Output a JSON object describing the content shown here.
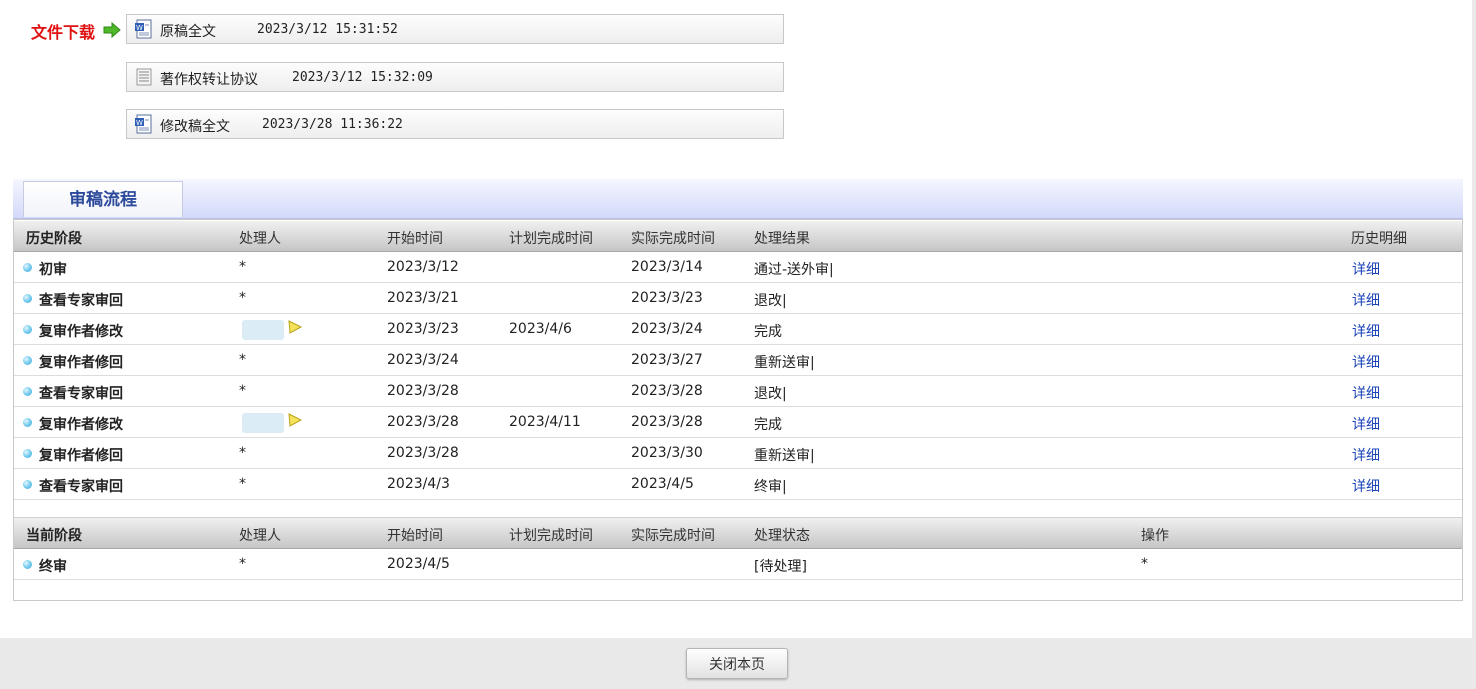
{
  "downloads": {
    "label": "文件下载",
    "files": [
      {
        "name": "原稿全文",
        "date": "2023/3/12 15:31:52",
        "icon": "word-doc-icon"
      },
      {
        "name": "著作权转让协议",
        "date": "2023/3/12 15:32:09",
        "icon": "text-doc-icon"
      },
      {
        "name": "修改稿全文",
        "date": "2023/3/28 11:36:22",
        "icon": "word-doc-icon"
      }
    ]
  },
  "section_title": "审稿流程",
  "history": {
    "headers": [
      "历史阶段",
      "处理人",
      "开始时间",
      "计划完成时间",
      "实际完成时间",
      "处理结果",
      "历史明细"
    ],
    "rows": [
      {
        "stage": "初审",
        "handler": "*",
        "start": "2023/3/12",
        "planned": "",
        "actual": "2023/3/14",
        "result": "通过-送外审|",
        "detail": "详细"
      },
      {
        "stage": "查看专家审回",
        "handler": "*",
        "start": "2023/3/21",
        "planned": "",
        "actual": "2023/3/23",
        "result": "退改|",
        "detail": "详细"
      },
      {
        "stage": "复审作者修改",
        "handler": "",
        "start": "2023/3/23",
        "planned": "2023/4/6",
        "actual": "2023/3/24",
        "result": "完成",
        "detail": "详细"
      },
      {
        "stage": "复审作者修回",
        "handler": "*",
        "start": "2023/3/24",
        "planned": "",
        "actual": "2023/3/27",
        "result": "重新送审|",
        "detail": "详细"
      },
      {
        "stage": "查看专家审回",
        "handler": "*",
        "start": "2023/3/28",
        "planned": "",
        "actual": "2023/3/28",
        "result": "退改|",
        "detail": "详细"
      },
      {
        "stage": "复审作者修改",
        "handler": "",
        "start": "2023/3/28",
        "planned": "2023/4/11",
        "actual": "2023/3/28",
        "result": "完成",
        "detail": "详细"
      },
      {
        "stage": "复审作者修回",
        "handler": "*",
        "start": "2023/3/28",
        "planned": "",
        "actual": "2023/3/30",
        "result": "重新送审|",
        "detail": "详细"
      },
      {
        "stage": "查看专家审回",
        "handler": "*",
        "start": "2023/4/3",
        "planned": "",
        "actual": "2023/4/5",
        "result": "终审|",
        "detail": "详细"
      }
    ]
  },
  "current": {
    "headers": [
      "当前阶段",
      "处理人",
      "开始时间",
      "计划完成时间",
      "实际完成时间",
      "处理状态",
      "操作"
    ],
    "rows": [
      {
        "stage": "终审",
        "handler": "*",
        "start": "2023/4/5",
        "planned": "",
        "actual": "",
        "status": "[待处理]",
        "action": "*"
      }
    ]
  },
  "footer": {
    "close_label": "关闭本页"
  },
  "colors": {
    "download_label": "#e01010",
    "section_title": "#2d4a9b",
    "link": "#1c44b8"
  }
}
